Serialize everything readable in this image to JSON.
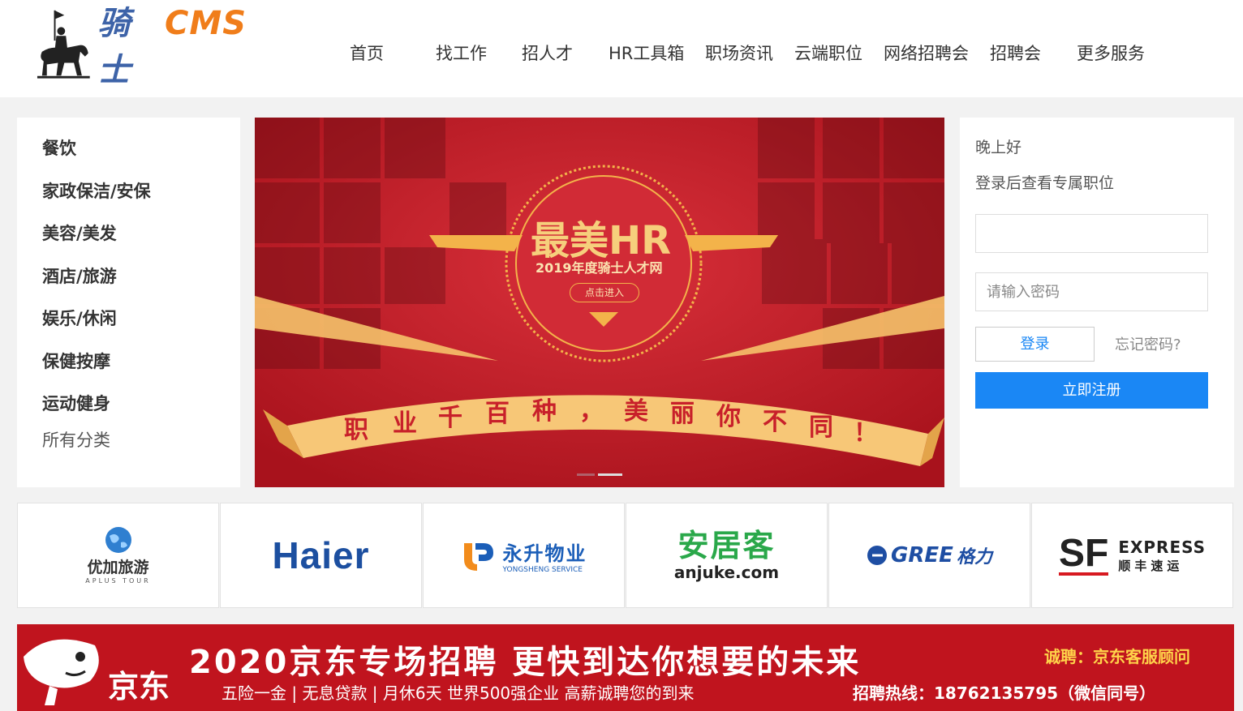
{
  "colors": {
    "accent_blue": "#1a87f5",
    "banner_red": "#c81e28",
    "ad_red": "#c0141e",
    "logo_blue": "#3d63a8",
    "logo_orange": "#f07d1a"
  },
  "header": {
    "logo": {
      "cn": "骑士",
      "en": "CMS",
      "icon": "knight-icon"
    },
    "nav": [
      "首页",
      "找工作",
      "招人才",
      "HR工具箱",
      "职场资讯",
      "云端职位",
      "网络招聘会",
      "招聘会",
      "更多服务"
    ]
  },
  "categories": {
    "items": [
      "餐饮",
      "家政保洁/安保",
      "美容/美发",
      "酒店/旅游",
      "娱乐/休闲",
      "保健按摩",
      "运动健身"
    ],
    "all_label": "所有分类"
  },
  "banner": {
    "title": "最美HR",
    "subtitle": "2019年度骑士人才网",
    "button": "点击进入",
    "slogan": [
      "职",
      "业",
      "千",
      "百",
      "种",
      "，",
      "美",
      "丽",
      "你",
      "不",
      "同",
      "！"
    ]
  },
  "login": {
    "greeting": "晚上好",
    "subtitle": "登录后查看专属职位",
    "username_value": "",
    "password_placeholder": "请输入密码",
    "login_button": "登录",
    "forgot_link": "忘记密码?",
    "register_button": "立即注册"
  },
  "partners": [
    {
      "name": "优加旅游",
      "sub": "APLUS TOUR"
    },
    {
      "name": "Haier"
    },
    {
      "name": "永升物业",
      "sub": "YONGSHENG SERVICE"
    },
    {
      "name": "安居客",
      "sub": "anjuke.com"
    },
    {
      "name": "GREE",
      "sub": "格力"
    },
    {
      "name": "EXPRESS",
      "sub": "顺丰速运",
      "mark": "SF"
    }
  ],
  "ad": {
    "brand": "京东",
    "title": "2020京东专场招聘  更快到达你想要的未来",
    "position": "诚聘：京东客服顾问",
    "benefits": "五险一金 | 无息贷款 | 月休6天  世界500强企业  高薪诚聘您的到来",
    "hotline": "招聘热线：18762135795（微信同号）"
  }
}
